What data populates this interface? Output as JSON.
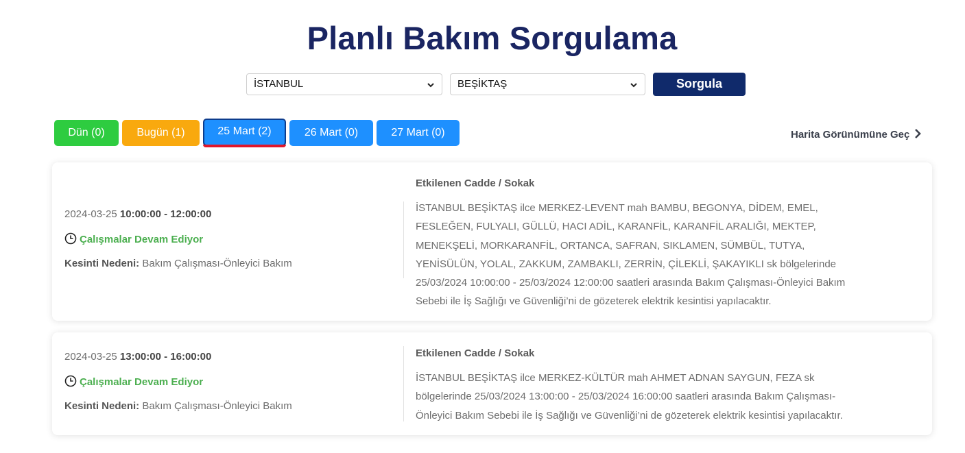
{
  "page": {
    "title": "Planlı Bakım Sorgulama"
  },
  "filters": {
    "city": "İSTANBUL",
    "district": "BEŞİKTAŞ",
    "query_label": "Sorgula"
  },
  "tabs": [
    {
      "label": "Dün (0)",
      "color": "#2ecc40"
    },
    {
      "label": "Bugün (1)",
      "color": "#f9a90e"
    },
    {
      "label": "25 Mart (2)",
      "color": "#1e90ff",
      "active": true
    },
    {
      "label": "26 Mart (0)",
      "color": "#1e90ff"
    },
    {
      "label": "27 Mart (0)",
      "color": "#1e90ff"
    }
  ],
  "map_link": "Harita Görünümüne Geç",
  "outages": [
    {
      "date": "2024-03-25",
      "time_range": "10:00:00 - 12:00:00",
      "status": "Çalışmalar Devam Ediyor",
      "reason_label": "Kesinti Nedeni:",
      "reason": "Bakım Çalışması-Önleyici Bakım",
      "streets_heading": "Etkilenen Cadde / Sokak",
      "description": "İSTANBUL BEŞİKTAŞ ilce MERKEZ-LEVENT mah BAMBU, BEGONYA, DİDEM, EMEL, FESLEĞEN, FULYALI, GÜLLÜ, HACI ADİL, KARANFİL, KARANFİL ARALIĞI, MEKTEP, MENEKŞELİ, MORKARANFİL, ORTANCA, SAFRAN, SIKLAMEN, SÜMBÜL, TUTYA, YENİSÜLÜN, YOLAL, ZAKKUM, ZAMBAKLI, ZERRİN, ÇİLEKLİ, ŞAKAYIKLI sk bölgelerinde 25/03/2024 10:00:00 - 25/03/2024 12:00:00 saatleri arasında Bakım Çalışması-Önleyici Bakım Sebebi ile İş Sağlığı ve Güvenliği’ni de gözeterek elektrik kesintisi yapılacaktır."
    },
    {
      "date": "2024-03-25",
      "time_range": "13:00:00 - 16:00:00",
      "status": "Çalışmalar Devam Ediyor",
      "reason_label": "Kesinti Nedeni:",
      "reason": "Bakım Çalışması-Önleyici Bakım",
      "streets_heading": "Etkilenen Cadde / Sokak",
      "description": "İSTANBUL BEŞİKTAŞ ilce MERKEZ-KÜLTÜR mah AHMET ADNAN SAYGUN, FEZA sk bölgelerinde 25/03/2024 13:00:00 - 25/03/2024 16:00:00 saatleri arasında Bakım Çalışması-Önleyici Bakım Sebebi ile İş Sağlığı ve Güvenliği’ni de gözeterek elektrik kesintisi yapılacaktır."
    }
  ]
}
